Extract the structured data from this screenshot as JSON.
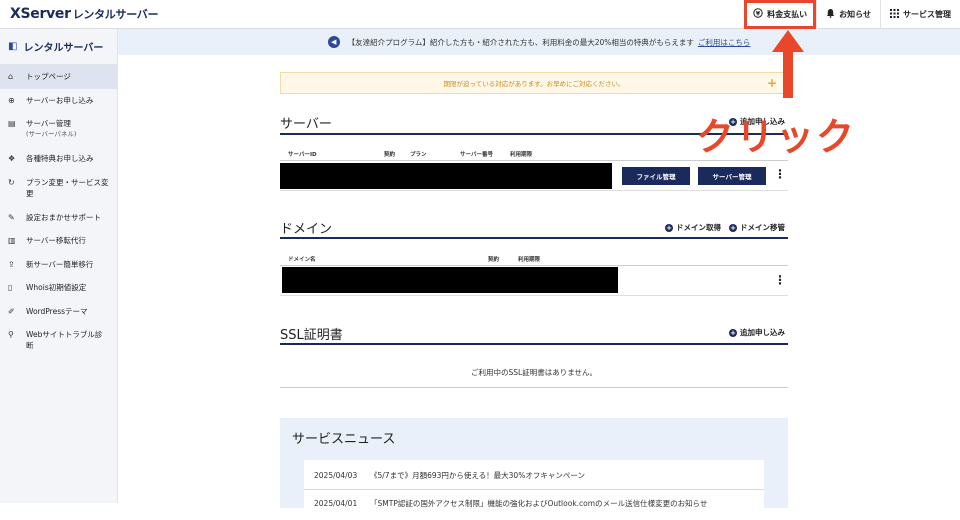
{
  "header": {
    "logo_main": "XServer",
    "logo_sub": "レンタルサーバー",
    "nav": [
      {
        "label": "料金支払い",
        "icon": "yen-circle-icon"
      },
      {
        "label": "お知らせ",
        "icon": "bell-icon"
      },
      {
        "label": "サービス管理",
        "icon": "grid-icon"
      }
    ]
  },
  "sidebar": {
    "title": "レンタルサーバー",
    "items": [
      {
        "label": "トップページ",
        "icon": "home-icon"
      },
      {
        "label": "サーバーお申し込み",
        "icon": "plus-circle-icon"
      },
      {
        "label": "サーバー管理",
        "sublabel": "(サーバーパネル)",
        "icon": "server-icon"
      },
      {
        "label": "各種特典お申し込み",
        "icon": "gift-icon"
      },
      {
        "label": "プラン変更・サービス変更",
        "icon": "refresh-icon"
      },
      {
        "label": "設定おまかせサポート",
        "icon": "wrench-icon"
      },
      {
        "label": "サーバー移転代行",
        "icon": "server-move-icon"
      },
      {
        "label": "新サーバー簡単移行",
        "icon": "migrate-icon"
      },
      {
        "label": "Whois初期値設定",
        "icon": "document-icon"
      },
      {
        "label": "WordPressテーマ",
        "icon": "edit-icon"
      },
      {
        "label": "Webサイトトラブル診断",
        "icon": "search-icon"
      }
    ]
  },
  "banner": {
    "text": "【友達紹介プログラム】紹介した方も・紹介された方も、利用料金の最大20%相当の特典がもらえます",
    "link": "ご利用はこちら"
  },
  "alert": {
    "text": "期限が迫っている対応があります。お早めにご対応ください。"
  },
  "server_section": {
    "title": "サーバー",
    "action": "追加申し込み",
    "columns": [
      "サーバーID",
      "契約",
      "プラン",
      "サーバー番号",
      "利用期限"
    ],
    "buttons": {
      "file": "ファイル管理",
      "panel": "サーバー管理"
    }
  },
  "domain_section": {
    "title": "ドメイン",
    "actions": [
      "ドメイン取得",
      "ドメイン移管"
    ],
    "columns": [
      "ドメイン名",
      "契約",
      "利用期限"
    ]
  },
  "ssl_section": {
    "title": "SSL証明書",
    "action": "追加申し込み",
    "empty": "ご利用中のSSL証明書はありません。"
  },
  "news": {
    "title": "サービスニュース",
    "items": [
      {
        "date": "2025/04/03",
        "text": "《5/7まで》月額693円から使える！最大30%オフキャンペーン"
      },
      {
        "date": "2025/04/01",
        "text": "「SMTP認証の国外アクセス制限」機能の強化およびOutlook.comのメール送信仕様変更のお知らせ"
      }
    ]
  },
  "annotation": {
    "text": "クリック",
    "color": "#e8472a"
  }
}
